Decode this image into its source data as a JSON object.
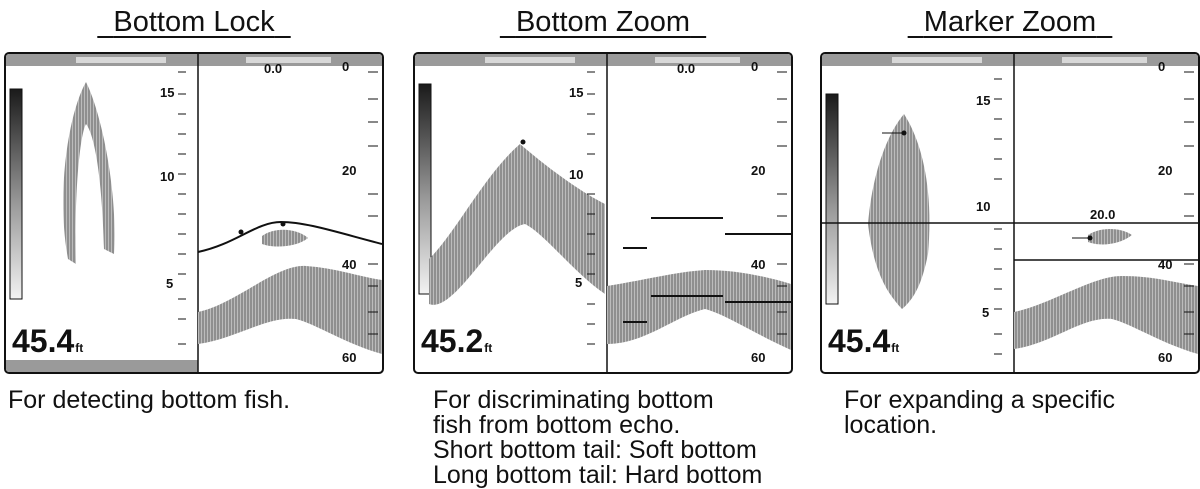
{
  "panels": [
    {
      "title": "Bottom Lock",
      "depth_value": "45.4",
      "depth_unit": "ft",
      "left_scale": [
        "15",
        "10",
        "5"
      ],
      "right_scale": [
        "0",
        "20",
        "40",
        "60"
      ],
      "top_value": "0.0",
      "marker_value": "",
      "caption": [
        "For detecting bottom fish."
      ]
    },
    {
      "title": "Bottom Zoom",
      "depth_value": "45.2",
      "depth_unit": "ft",
      "left_scale": [
        "15",
        "10",
        "5"
      ],
      "right_scale": [
        "0",
        "20",
        "40",
        "60"
      ],
      "top_value": "0.0",
      "marker_value": "",
      "caption": [
        "For discriminating bottom",
        "fish from bottom echo.",
        "Short bottom tail: Soft bottom",
        "Long bottom tail: Hard bottom"
      ]
    },
    {
      "title": "Marker Zoom",
      "depth_value": "45.4",
      "depth_unit": "ft",
      "left_scale": [
        "15",
        "10",
        "5"
      ],
      "right_scale": [
        "0",
        "20",
        "40",
        "60"
      ],
      "top_value": "",
      "marker_value": "20.0",
      "caption": [
        "For expanding a specific",
        "location."
      ]
    }
  ],
  "colors": {
    "frame": "#111111",
    "echo": "#8a8a8a",
    "strip": "#9a9a9a"
  }
}
